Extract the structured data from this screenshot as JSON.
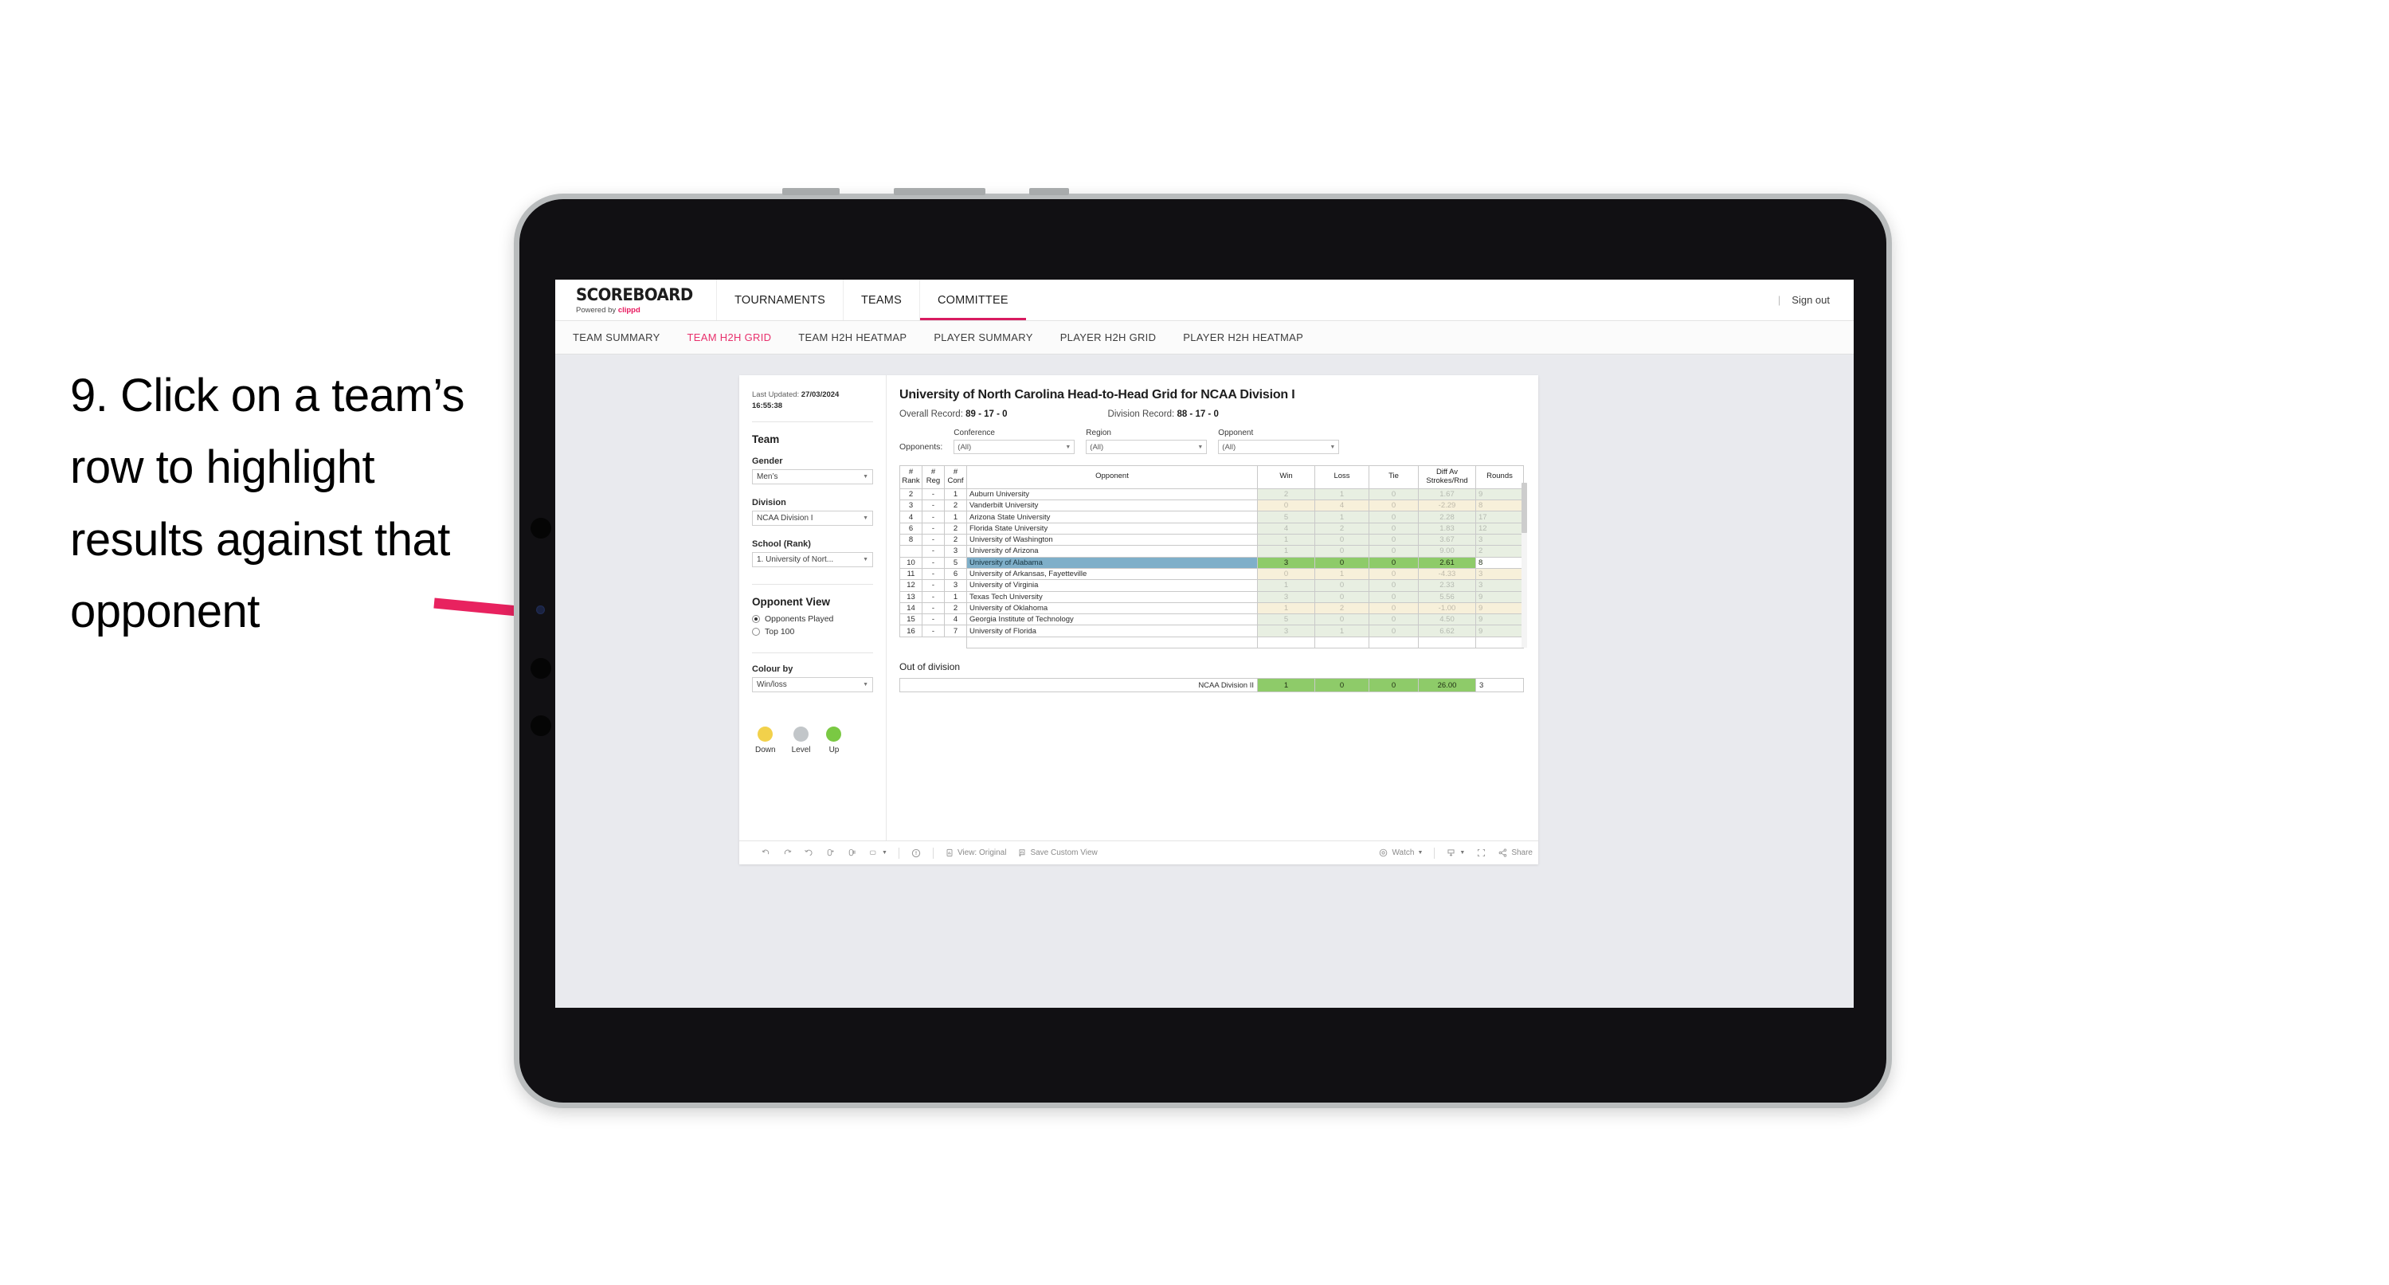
{
  "annotation": {
    "text": "9. Click on a team’s row to highlight results against that opponent",
    "arrow_color": "#e8225f"
  },
  "topnav": {
    "brand_title": "SCOREBOARD",
    "brand_sub_prefix": "Powered by ",
    "brand_sub_brand": "clippd",
    "items": [
      {
        "label": "TOURNAMENTS",
        "active": false
      },
      {
        "label": "TEAMS",
        "active": false
      },
      {
        "label": "COMMITTEE",
        "active": true
      }
    ],
    "separator": "|",
    "sign_out": "Sign out"
  },
  "subnav": {
    "items": [
      {
        "label": "TEAM SUMMARY",
        "active": false
      },
      {
        "label": "TEAM H2H GRID",
        "active": true
      },
      {
        "label": "TEAM H2H HEATMAP",
        "active": false
      },
      {
        "label": "PLAYER SUMMARY",
        "active": false
      },
      {
        "label": "PLAYER H2H GRID",
        "active": false
      },
      {
        "label": "PLAYER H2H HEATMAP",
        "active": false
      }
    ]
  },
  "filters": {
    "last_updated_label": "Last Updated: ",
    "last_updated_date": "27/03/2024",
    "last_updated_time": "16:55:38",
    "team_heading": "Team",
    "gender_label": "Gender",
    "gender_value": "Men’s",
    "division_label": "Division",
    "division_value": "NCAA Division I",
    "school_label": "School (Rank)",
    "school_value": "1. University of Nort...",
    "opponent_view_heading": "Opponent View",
    "opponent_view_options": [
      {
        "label": "Opponents Played",
        "selected": true
      },
      {
        "label": "Top 100",
        "selected": false
      }
    ],
    "colour_by_label": "Colour by",
    "colour_by_value": "Win/loss",
    "legend": [
      {
        "label": "Down",
        "color": "#f2d14b"
      },
      {
        "label": "Level",
        "color": "#c2c6c9"
      },
      {
        "label": "Up",
        "color": "#7ac943"
      }
    ]
  },
  "viz": {
    "title": "University of North Carolina Head-to-Head Grid for NCAA Division I",
    "overall_record_label": "Overall Record: ",
    "overall_record_value": "89 - 17 - 0",
    "division_record_label": "Division Record: ",
    "division_record_value": "88 - 17 - 0",
    "opponents_label": "Opponents:",
    "opponent_filters": [
      {
        "label": "Conference",
        "value": "(All)"
      },
      {
        "label": "Region",
        "value": "(All)"
      },
      {
        "label": "Opponent",
        "value": "(All)"
      }
    ],
    "out_of_division_title": "Out of division",
    "out_of_division_row": {
      "label": "NCAA Division II",
      "win": "1",
      "loss": "0",
      "tie": "0",
      "diff": "26.00",
      "rounds": "3"
    }
  },
  "chart_data": {
    "type": "table",
    "title": "University of North Carolina Head-to-Head Grid for NCAA Division I",
    "columns": [
      "# Rank",
      "# Reg",
      "# Conf",
      "Opponent",
      "Win",
      "Loss",
      "Tie",
      "Diff Av Strokes/Rnd",
      "Rounds"
    ],
    "column_header_lines": [
      [
        "#",
        "Rank"
      ],
      [
        "#",
        "Reg"
      ],
      [
        "#",
        "Conf"
      ],
      [
        "Opponent"
      ],
      [
        "Win"
      ],
      [
        "Loss"
      ],
      [
        "Tie"
      ],
      [
        "Diff Av",
        "Strokes/Rnd"
      ],
      [
        "Rounds"
      ]
    ],
    "rows": [
      {
        "rank": "2",
        "reg": "-",
        "conf": "1",
        "opponent": "Auburn University",
        "win": "2",
        "loss": "1",
        "tie": "0",
        "diff": "1.67",
        "rounds": "9",
        "tint": "green",
        "selected": false
      },
      {
        "rank": "3",
        "reg": "-",
        "conf": "2",
        "opponent": "Vanderbilt University",
        "win": "0",
        "loss": "4",
        "tie": "0",
        "diff": "-2.29",
        "rounds": "8",
        "tint": "yellow",
        "selected": false
      },
      {
        "rank": "4",
        "reg": "-",
        "conf": "1",
        "opponent": "Arizona State University",
        "win": "5",
        "loss": "1",
        "tie": "0",
        "diff": "2.28",
        "rounds": "17",
        "tint": "green",
        "selected": false
      },
      {
        "rank": "6",
        "reg": "-",
        "conf": "2",
        "opponent": "Florida State University",
        "win": "4",
        "loss": "2",
        "tie": "0",
        "diff": "1.83",
        "rounds": "12",
        "tint": "green",
        "selected": false
      },
      {
        "rank": "8",
        "reg": "-",
        "conf": "2",
        "opponent": "University of Washington",
        "win": "1",
        "loss": "0",
        "tie": "0",
        "diff": "3.67",
        "rounds": "3",
        "tint": "green",
        "selected": false
      },
      {
        "rank": "",
        "reg": "-",
        "conf": "3",
        "opponent": "University of Arizona",
        "win": "1",
        "loss": "0",
        "tie": "0",
        "diff": "9.00",
        "rounds": "2",
        "tint": "green",
        "selected": false
      },
      {
        "rank": "10",
        "reg": "-",
        "conf": "5",
        "opponent": "University of Alabama",
        "win": "3",
        "loss": "0",
        "tie": "0",
        "diff": "2.61",
        "rounds": "8",
        "tint": "green",
        "selected": true
      },
      {
        "rank": "11",
        "reg": "-",
        "conf": "6",
        "opponent": "University of Arkansas, Fayetteville",
        "win": "0",
        "loss": "1",
        "tie": "0",
        "diff": "-4.33",
        "rounds": "3",
        "tint": "yellow",
        "selected": false
      },
      {
        "rank": "12",
        "reg": "-",
        "conf": "3",
        "opponent": "University of Virginia",
        "win": "1",
        "loss": "0",
        "tie": "0",
        "diff": "2.33",
        "rounds": "3",
        "tint": "green",
        "selected": false
      },
      {
        "rank": "13",
        "reg": "-",
        "conf": "1",
        "opponent": "Texas Tech University",
        "win": "3",
        "loss": "0",
        "tie": "0",
        "diff": "5.56",
        "rounds": "9",
        "tint": "green",
        "selected": false
      },
      {
        "rank": "14",
        "reg": "-",
        "conf": "2",
        "opponent": "University of Oklahoma",
        "win": "1",
        "loss": "2",
        "tie": "0",
        "diff": "-1.00",
        "rounds": "9",
        "tint": "yellow",
        "selected": false
      },
      {
        "rank": "15",
        "reg": "-",
        "conf": "4",
        "opponent": "Georgia Institute of Technology",
        "win": "5",
        "loss": "0",
        "tie": "0",
        "diff": "4.50",
        "rounds": "9",
        "tint": "green",
        "selected": false
      },
      {
        "rank": "16",
        "reg": "-",
        "conf": "7",
        "opponent": "University of Florida",
        "win": "3",
        "loss": "1",
        "tie": "0",
        "diff": "6.62",
        "rounds": "9",
        "tint": "green",
        "selected": false
      }
    ],
    "selected_row_color": "#7fafc9",
    "highlight_value_color": "#8ecb69"
  },
  "toolbar": {
    "items": [
      {
        "name": "undo",
        "label": ""
      },
      {
        "name": "redo",
        "label": ""
      },
      {
        "name": "revert",
        "label": ""
      },
      {
        "name": "refresh",
        "label": ""
      },
      {
        "name": "pause",
        "label": ""
      },
      {
        "name": "view-dropdown",
        "label": ""
      },
      {
        "name": "help",
        "label": ""
      },
      {
        "name": "view-original",
        "label": "View: Original"
      },
      {
        "name": "save-custom-view",
        "label": "Save Custom View"
      },
      {
        "name": "watch",
        "label": "Watch"
      },
      {
        "name": "download",
        "label": ""
      },
      {
        "name": "fullscreen",
        "label": ""
      },
      {
        "name": "share",
        "label": "Share"
      }
    ],
    "view_original_label": "View: Original",
    "save_custom_view_label": "Save Custom View",
    "watch_label": "Watch",
    "share_label": "Share"
  }
}
